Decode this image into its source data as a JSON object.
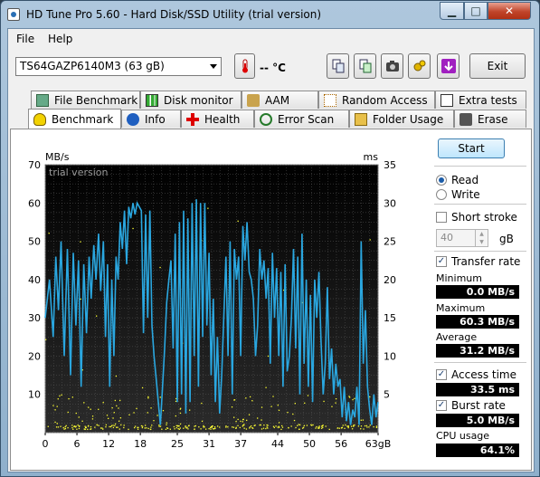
{
  "window": {
    "title": "HD Tune Pro 5.60 - Hard Disk/SSD Utility (trial version)"
  },
  "menu": [
    {
      "label": "File"
    },
    {
      "label": "Help"
    }
  ],
  "toolbar": {
    "drive": "TS64GAZP6140M3 (63 gB)",
    "temperature": "-- °C",
    "exit_label": "Exit",
    "icons": [
      "copy-icon",
      "copy-info-icon",
      "screenshot-icon",
      "options-icon",
      "save-icon"
    ]
  },
  "tabs_top": [
    {
      "label": "File Benchmark",
      "icon": "file-benchmark-icon"
    },
    {
      "label": "Disk monitor",
      "icon": "disk-monitor-icon"
    },
    {
      "label": "AAM",
      "icon": "speaker-icon"
    },
    {
      "label": "Random Access",
      "icon": "random-access-icon"
    },
    {
      "label": "Extra tests",
      "icon": "extra-tests-icon"
    }
  ],
  "tabs_bottom": [
    {
      "label": "Benchmark",
      "icon": "benchmark-icon"
    },
    {
      "label": "Info",
      "icon": "info-icon"
    },
    {
      "label": "Health",
      "icon": "health-icon"
    },
    {
      "label": "Error Scan",
      "icon": "error-scan-icon"
    },
    {
      "label": "Folder Usage",
      "icon": "folder-icon"
    },
    {
      "label": "Erase",
      "icon": "erase-icon"
    }
  ],
  "side": {
    "start_label": "Start",
    "read_label": "Read",
    "write_label": "Write",
    "mode": "read",
    "short_stroke_label": "Short stroke",
    "short_stroke_value": "40",
    "short_stroke_unit": "gB",
    "transfer_rate_label": "Transfer rate",
    "minimum_label": "Minimum",
    "minimum_value": "0.0 MB/s",
    "maximum_label": "Maximum",
    "maximum_value": "60.3 MB/s",
    "average_label": "Average",
    "average_value": "31.2 MB/s",
    "access_time_label": "Access time",
    "access_time_value": "33.5 ms",
    "burst_rate_label": "Burst rate",
    "burst_rate_value": "5.0 MB/s",
    "cpu_usage_label": "CPU usage",
    "cpu_usage_value": "64.1%"
  },
  "chart_data": {
    "type": "line",
    "watermark": "trial version",
    "ylabel_left": "MB/s",
    "ylabel_right": "ms",
    "ylim_left": [
      0,
      70
    ],
    "ylim_right": [
      0,
      35
    ],
    "yticks_left": [
      10,
      20,
      30,
      40,
      50,
      60,
      70
    ],
    "yticks_right": [
      5,
      10,
      15,
      20,
      25,
      30,
      35
    ],
    "xlim": [
      0,
      63
    ],
    "xticks": [
      "0",
      "6",
      "12",
      "18",
      "25",
      "31",
      "37",
      "44",
      "50",
      "56",
      "63gB"
    ],
    "grid": true,
    "series": [
      {
        "axis": "left",
        "color": "#2aa7e0",
        "x": [
          0,
          0.8,
          1.5,
          2,
          2.5,
          3,
          3.6,
          4.2,
          4.8,
          5.3,
          5.8,
          6.3,
          6.8,
          7.3,
          7.8,
          8.3,
          8.7,
          9.2,
          9.6,
          10.1,
          10.5,
          11,
          11.4,
          11.8,
          12.2,
          12.6,
          13,
          13.4,
          13.8,
          14.2,
          14.6,
          15,
          15.4,
          15.8,
          16.2,
          16.6,
          17,
          17.4,
          17.8,
          18.2,
          18.6,
          19,
          19.4,
          19.8,
          20.2,
          20.6,
          21,
          21.4,
          21.8,
          22.2,
          22.6,
          23,
          23.4,
          23.8,
          24.2,
          24.6,
          25,
          25.4,
          25.8,
          26.2,
          26.6,
          27,
          27.4,
          27.8,
          28.2,
          28.6,
          29,
          29.4,
          29.8,
          30.2,
          30.6,
          31,
          31.4,
          31.8,
          32.2,
          32.6,
          33,
          33.4,
          33.8,
          34.2,
          34.6,
          35,
          35.4,
          35.8,
          36.2,
          36.6,
          37,
          37.4,
          37.8,
          38.2,
          38.6,
          39,
          39.4,
          39.8,
          40.2,
          40.6,
          41,
          41.4,
          41.8,
          42.2,
          42.6,
          43,
          43.4,
          43.8,
          44.2,
          44.6,
          45,
          45.4,
          45.8,
          46.2,
          46.6,
          47,
          47.4,
          47.8,
          48.2,
          48.6,
          49,
          49.4,
          49.8,
          50.2,
          50.6,
          51,
          51.4,
          51.8,
          52.2,
          52.6,
          53,
          53.4,
          53.8,
          54.2,
          54.6,
          55,
          55.4,
          55.8,
          56.2,
          56.6,
          57,
          57.4,
          57.8,
          58.2,
          58.6,
          59,
          59.4,
          59.8,
          60.2,
          60.6,
          61,
          61.4,
          61.8,
          62.2,
          62.6,
          63
        ],
        "y": [
          30,
          40,
          25,
          46,
          32,
          50,
          20,
          48,
          15,
          47,
          28,
          45,
          12,
          44,
          26,
          46,
          35,
          49,
          40,
          52,
          37,
          50,
          25,
          44,
          12,
          40,
          20,
          46,
          40,
          55,
          48,
          58,
          44,
          59,
          56,
          60,
          57,
          60,
          59,
          58,
          26,
          57,
          30,
          58,
          28,
          20,
          14,
          8,
          2,
          12,
          22,
          34,
          40,
          45,
          22,
          52,
          8,
          55,
          10,
          58,
          5,
          56,
          8,
          60,
          20,
          61,
          12,
          60,
          25,
          60,
          28,
          47,
          15,
          35,
          8,
          25,
          5,
          15,
          30,
          46,
          20,
          50,
          10,
          48,
          40,
          46,
          20,
          54,
          45,
          55,
          42,
          40,
          35,
          20,
          28,
          48,
          40,
          45,
          35,
          43,
          18,
          47,
          30,
          43,
          20,
          42,
          12,
          44,
          16,
          20,
          30,
          48,
          22,
          46,
          10,
          52,
          18,
          40,
          12,
          36,
          8,
          40,
          30,
          42,
          24,
          10,
          18,
          38,
          14,
          22,
          10,
          18,
          12,
          14,
          4,
          12,
          3,
          8,
          2,
          6,
          4,
          12,
          2,
          50,
          18,
          32,
          12,
          6,
          2,
          10,
          4,
          8
        ]
      },
      {
        "axis": "right",
        "color": "#ffff33",
        "kind": "scatter",
        "note_points_low": true
      }
    ]
  }
}
